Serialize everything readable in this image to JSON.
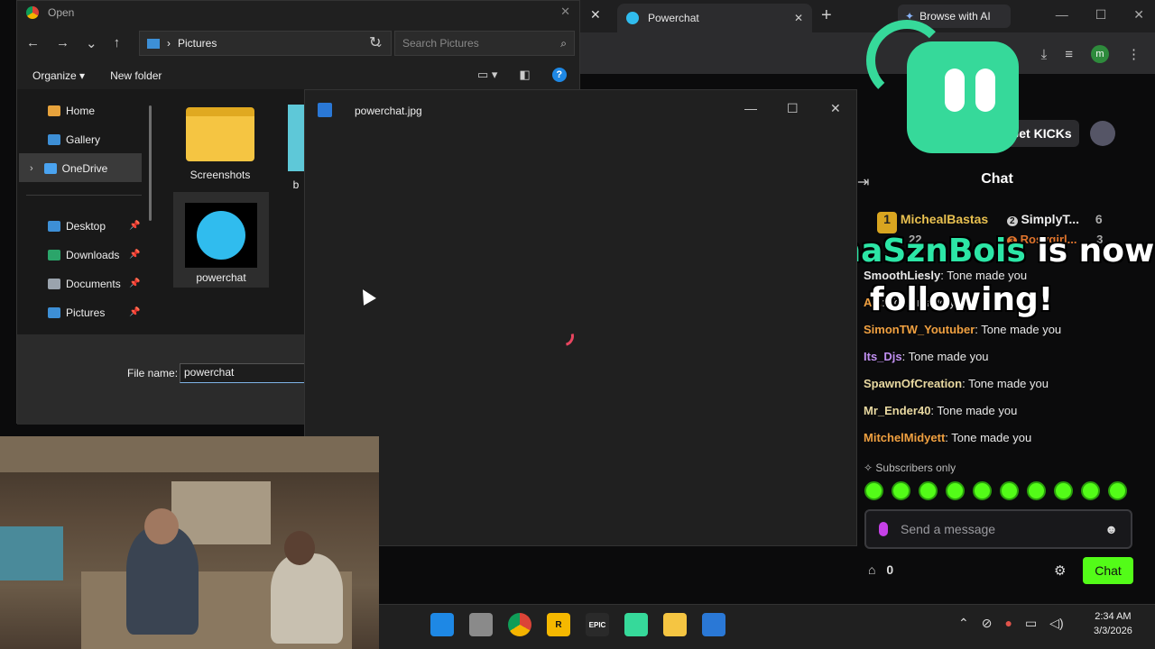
{
  "browser": {
    "tab_title": "Powerchat",
    "browse_ai_label": "Browse with AI",
    "profile_initial": "m"
  },
  "kick": {
    "get_kicks_label": "Get KICKs",
    "chat_title": "Chat",
    "leaderboard": [
      {
        "rank": "1",
        "name": "MichealBastas",
        "count": "22"
      },
      {
        "rank": "2",
        "name": "SimplyT...",
        "count": "6"
      },
      {
        "rank": "3",
        "name": "Rosygirl...",
        "count": "3"
      }
    ],
    "messages": [
      {
        "user": "SmoothLiesly",
        "text": "Tone made you",
        "color": "#e8e8e8"
      },
      {
        "user": "A...",
        "text": "Tone made you",
        "color": "#f0a040"
      },
      {
        "user": "SimonTW_Youtuber",
        "text": "Tone made you",
        "color": "#f0a040"
      },
      {
        "user": "Its_Djs",
        "text": "Tone made you",
        "color": "#c08ff0"
      },
      {
        "user": "SpawnOfCreation",
        "text": "Tone made you",
        "color": "#e8d8a0"
      },
      {
        "user": "Mr_Ender40",
        "text": "Tone made you",
        "color": "#e8d8a0"
      },
      {
        "user": "MitchelMidyett",
        "text": "Tone made you",
        "color": "#f0a040"
      }
    ],
    "subscribers_only": "Subscribers only",
    "message_placeholder": "Send a message",
    "store_count": "0",
    "chat_button": "Chat",
    "accent_color": "#53fc18"
  },
  "overlay": {
    "follow_name": "RonaSznBois",
    "follow_suffix": " is now",
    "follow_line2": "following!"
  },
  "file_dialog": {
    "title": "Open",
    "path": "Pictures",
    "search_placeholder": "Search Pictures",
    "organize": "Organize",
    "new_folder": "New folder",
    "nav": {
      "home": "Home",
      "gallery": "Gallery",
      "onedrive": "OneDrive",
      "desktop": "Desktop",
      "downloads": "Downloads",
      "documents": "Documents",
      "pictures": "Pictures"
    },
    "files": {
      "screenshots": "Screenshots",
      "partial": "b",
      "powerchat": "powerchat"
    },
    "file_name_label": "File name:",
    "file_name_value": "powerchat"
  },
  "viewer": {
    "title": "powerchat.jpg"
  },
  "taskbar": {
    "time": "2:34 AM",
    "date": "3/3/2026"
  }
}
